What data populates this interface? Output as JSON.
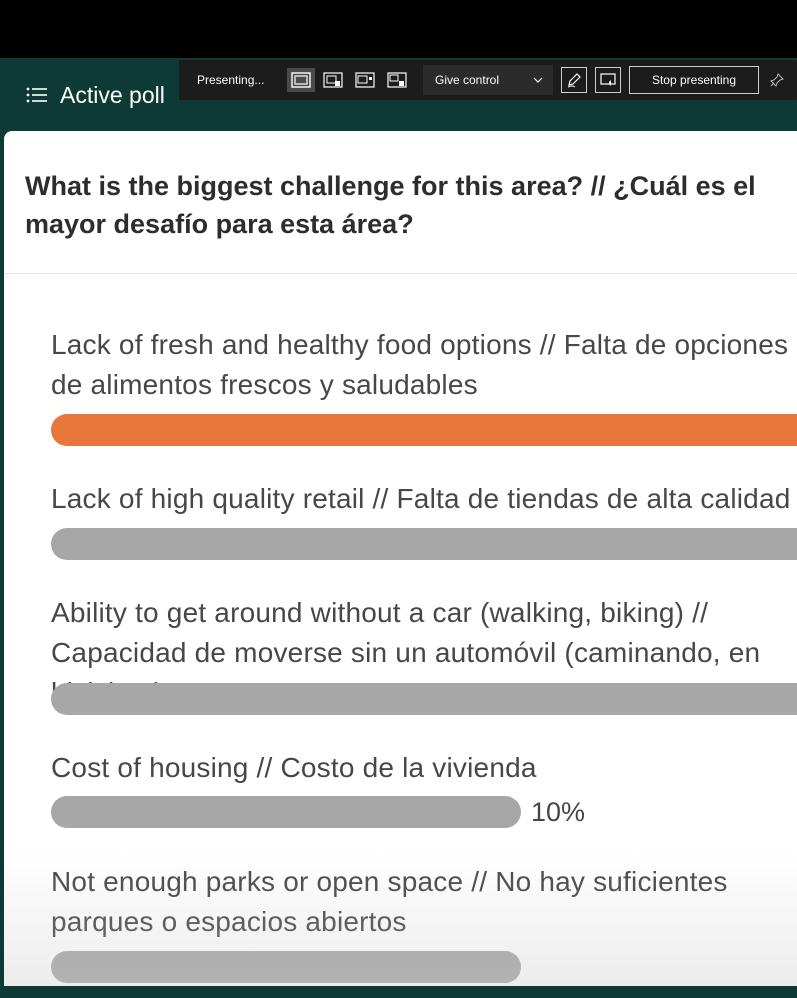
{
  "header": {
    "title": "Active poll",
    "icon": "list-icon"
  },
  "toolbar": {
    "status": "Presenting...",
    "layout_buttons": [
      "layout-content-only-icon",
      "layout-standout-icon",
      "layout-side-by-side-icon",
      "layout-reporter-icon"
    ],
    "give_control_label": "Give control",
    "stop_label": "Stop presenting"
  },
  "poll": {
    "question": "What is the biggest challenge for this area? // ¿Cuál es el mayor desafío para esta área?",
    "options": [
      {
        "label": "Lack of fresh and healthy food options // Falta de opciones de alimentos frescos y saludables",
        "fraction": 1.0,
        "leading": true
      },
      {
        "label": "Lack of high quality retail // Falta de tiendas de alta calidad",
        "fraction": 1.0,
        "leading": false
      },
      {
        "label": "Ability to get around without a car (walking, biking) // Capacidad de moverse sin un automóvil (caminando, en bicicleta)",
        "fraction": 1.0,
        "leading": false
      },
      {
        "label": "Cost of housing // Costo de la vivienda",
        "fraction": 0.1,
        "percent": "10%",
        "leading": false
      },
      {
        "label": "Not enough parks or open space // No hay suficientes parques o espacios abiertos",
        "fraction": 0.1,
        "leading": false
      }
    ]
  },
  "colors": {
    "leading_bar": "#e8773b",
    "bar": "#a7a7a7",
    "background": "#0d3a35"
  }
}
